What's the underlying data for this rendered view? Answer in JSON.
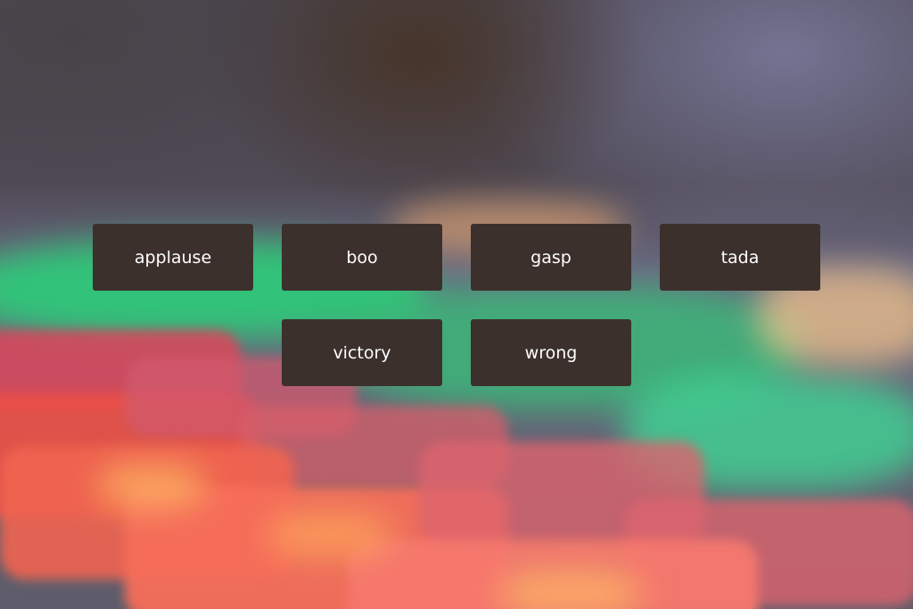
{
  "soundboard": {
    "row1": [
      {
        "label": "applause"
      },
      {
        "label": "boo"
      },
      {
        "label": "gasp"
      },
      {
        "label": "tada"
      }
    ],
    "row2": [
      {
        "label": "victory"
      },
      {
        "label": "wrong"
      }
    ]
  },
  "colors": {
    "button_bg": "#3c302c",
    "button_text": "#ffffff"
  }
}
